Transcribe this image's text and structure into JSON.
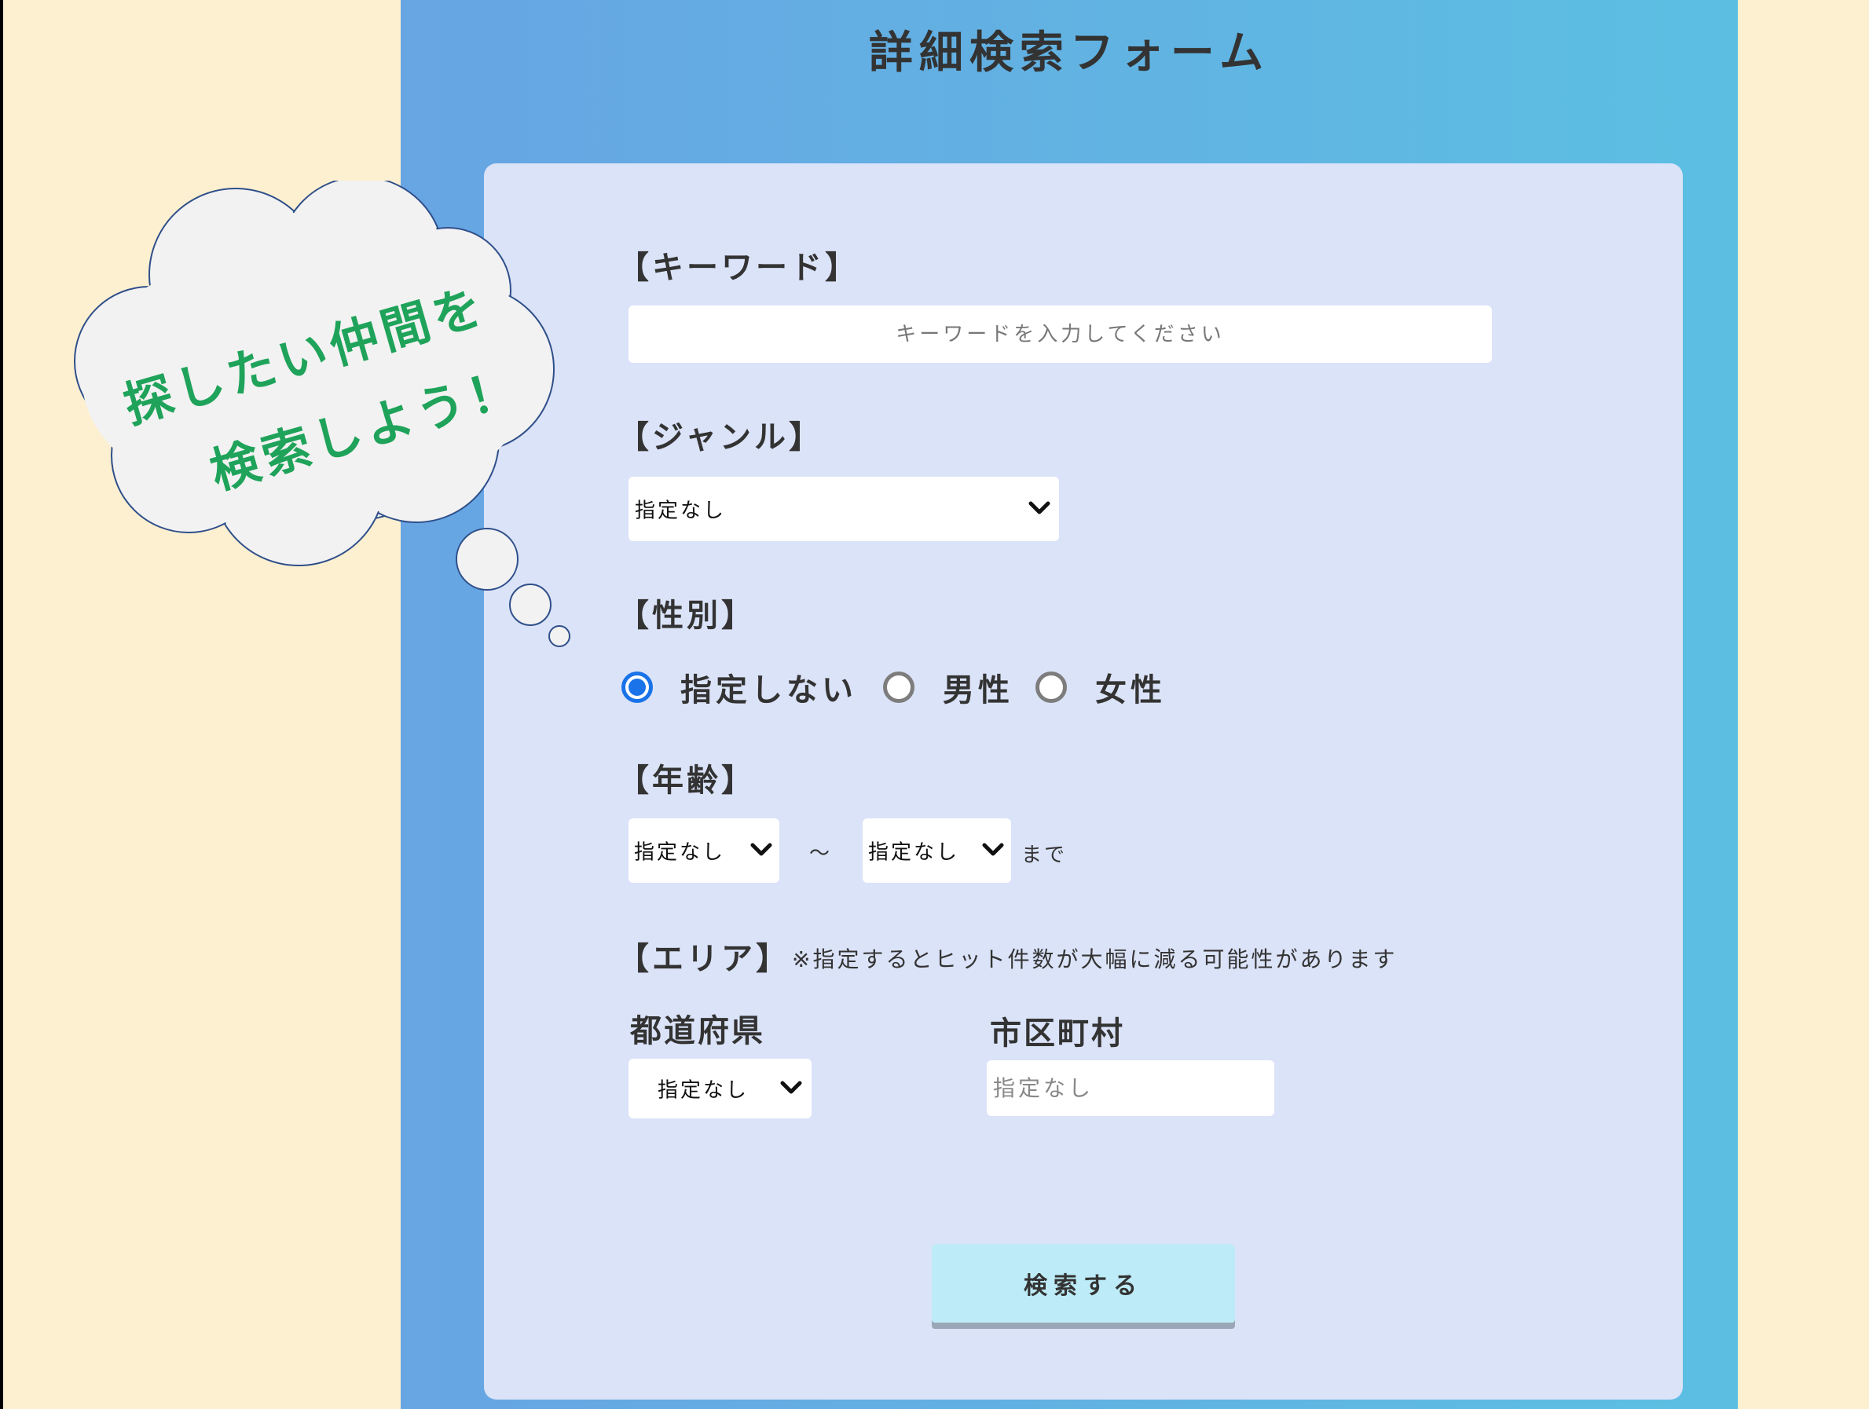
{
  "page": {
    "title": "詳細検索フォーム"
  },
  "callout": {
    "line1": "探したい仲間を",
    "line2": "検索しよう！"
  },
  "keyword": {
    "label": "【キーワード】",
    "placeholder": "キーワードを入力してください"
  },
  "genre": {
    "label": "【ジャンル】",
    "selected": "指定なし"
  },
  "gender": {
    "label": "【性別】",
    "options": [
      {
        "label": "指定しない",
        "checked": true
      },
      {
        "label": "男性",
        "checked": false
      },
      {
        "label": "女性",
        "checked": false
      }
    ]
  },
  "age": {
    "label": "【年齢】",
    "from_selected": "指定なし",
    "separator": "～",
    "to_selected": "指定なし",
    "suffix": "まで"
  },
  "area": {
    "label": "【エリア】",
    "note": "※指定するとヒット件数が大幅に減る可能性があります",
    "prefecture_label": "都道府県",
    "prefecture_selected": "指定なし",
    "city_label": "市区町村",
    "city_placeholder": "指定なし"
  },
  "submit": {
    "label": "検索する"
  },
  "colors": {
    "background": "#fdf0d0",
    "main_column_start": "#67a5e3",
    "main_column_end": "#5cbfe2",
    "card": "#dbe3f8",
    "radio_checked": "#1a73e8",
    "callout_text": "#1fa35a",
    "button": "#bdebf7"
  }
}
